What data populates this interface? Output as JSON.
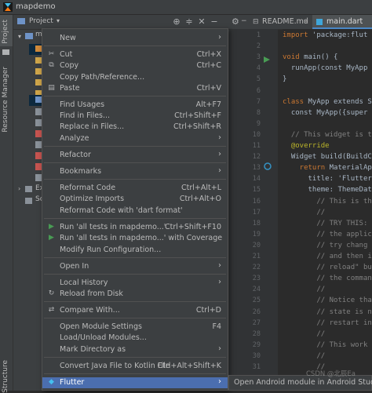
{
  "window": {
    "title": "mapdemo"
  },
  "side_tabs": {
    "project": "Project",
    "resource_manager": "Resource Manager",
    "structure": "Structure"
  },
  "project_panel": {
    "header": "Project",
    "root": "m",
    "tree_items": [
      "Ex",
      "Sc"
    ]
  },
  "editor_tabs": [
    {
      "label": "README.md",
      "active": false
    },
    {
      "label": "main.dart",
      "active": true
    }
  ],
  "line_numbers": [
    "1",
    "2",
    "3",
    "4",
    "5",
    "6",
    "7",
    "8",
    "9",
    "10",
    "11",
    "12",
    "13",
    "14",
    "15",
    "16",
    "17",
    "18",
    "19",
    "20",
    "21",
    "22",
    "23",
    "24",
    "25",
    "26",
    "27",
    "28",
    "29",
    "30",
    "31"
  ],
  "code_lines": [
    {
      "k": "import",
      "r": " 'package:flut"
    },
    {
      "r": ""
    },
    {
      "k": "void",
      "r": " main() {"
    },
    {
      "r": "  runApp(const MyApp"
    },
    {
      "r": "}"
    },
    {
      "r": ""
    },
    {
      "k": "class",
      "r": " MyApp extends S"
    },
    {
      "r": "  const MyApp({super"
    },
    {
      "r": ""
    },
    {
      "c": "  // This widget is t"
    },
    {
      "a": "  @override"
    },
    {
      "r": "  Widget build(BuildC"
    },
    {
      "k": "    return",
      "r": " MaterialAp"
    },
    {
      "r": "      title: 'Flutter"
    },
    {
      "r": "      theme: ThemeDat"
    },
    {
      "c": "        // This is th"
    },
    {
      "c": "        //"
    },
    {
      "c": "        // TRY THIS: "
    },
    {
      "c": "        // the applic"
    },
    {
      "c": "        // try chang"
    },
    {
      "c": "        // and then i"
    },
    {
      "c": "        // reload\" bu"
    },
    {
      "c": "        // the comman"
    },
    {
      "c": "        //"
    },
    {
      "c": "        // Notice tha"
    },
    {
      "c": "        // state is n"
    },
    {
      "c": "        // restart in"
    },
    {
      "c": "        //"
    },
    {
      "c": "        // This work"
    },
    {
      "c": "        //"
    },
    {
      "c": "        //"
    }
  ],
  "menu": {
    "items": [
      {
        "label": "New",
        "arrow": true
      },
      {
        "label": "Cut",
        "shortcut": "Ctrl+X",
        "icon": "✂"
      },
      {
        "label": "Copy",
        "shortcut": "Ctrl+C",
        "icon": "⧉"
      },
      {
        "label": "Copy Path/Reference..."
      },
      {
        "label": "Paste",
        "shortcut": "Ctrl+V",
        "icon": "▤"
      },
      {
        "label": "Find Usages",
        "shortcut": "Alt+F7"
      },
      {
        "label": "Find in Files...",
        "shortcut": "Ctrl+Shift+F"
      },
      {
        "label": "Replace in Files...",
        "shortcut": "Ctrl+Shift+R"
      },
      {
        "label": "Analyze",
        "arrow": true
      },
      {
        "label": "Refactor",
        "arrow": true
      },
      {
        "label": "Bookmarks",
        "arrow": true
      },
      {
        "label": "Reformat Code",
        "shortcut": "Ctrl+Alt+L"
      },
      {
        "label": "Optimize Imports",
        "shortcut": "Ctrl+Alt+O"
      },
      {
        "label": "Reformat Code with 'dart format'"
      },
      {
        "label": "Run 'all tests in mapdemo...'",
        "shortcut": "Ctrl+Shift+F10",
        "icon": "▶"
      },
      {
        "label": "Run 'all tests in mapdemo...' with Coverage",
        "icon": "▶"
      },
      {
        "label": "Modify Run Configuration..."
      },
      {
        "label": "Open In",
        "arrow": true
      },
      {
        "label": "Local History",
        "arrow": true
      },
      {
        "label": "Reload from Disk",
        "icon": "↻"
      },
      {
        "label": "Compare With...",
        "shortcut": "Ctrl+D",
        "icon": "⇄"
      },
      {
        "label": "Open Module Settings",
        "shortcut": "F4"
      },
      {
        "label": "Load/Unload Modules..."
      },
      {
        "label": "Mark Directory as",
        "arrow": true
      },
      {
        "label": "Convert Java File to Kotlin File",
        "shortcut": "Ctrl+Alt+Shift+K"
      },
      {
        "label": "Flutter",
        "arrow": true,
        "icon": "◆",
        "highlighted": true
      }
    ]
  },
  "submenu": {
    "item": "Open Android module in Android Studio"
  },
  "watermark": "CSDN @北辰Ea"
}
